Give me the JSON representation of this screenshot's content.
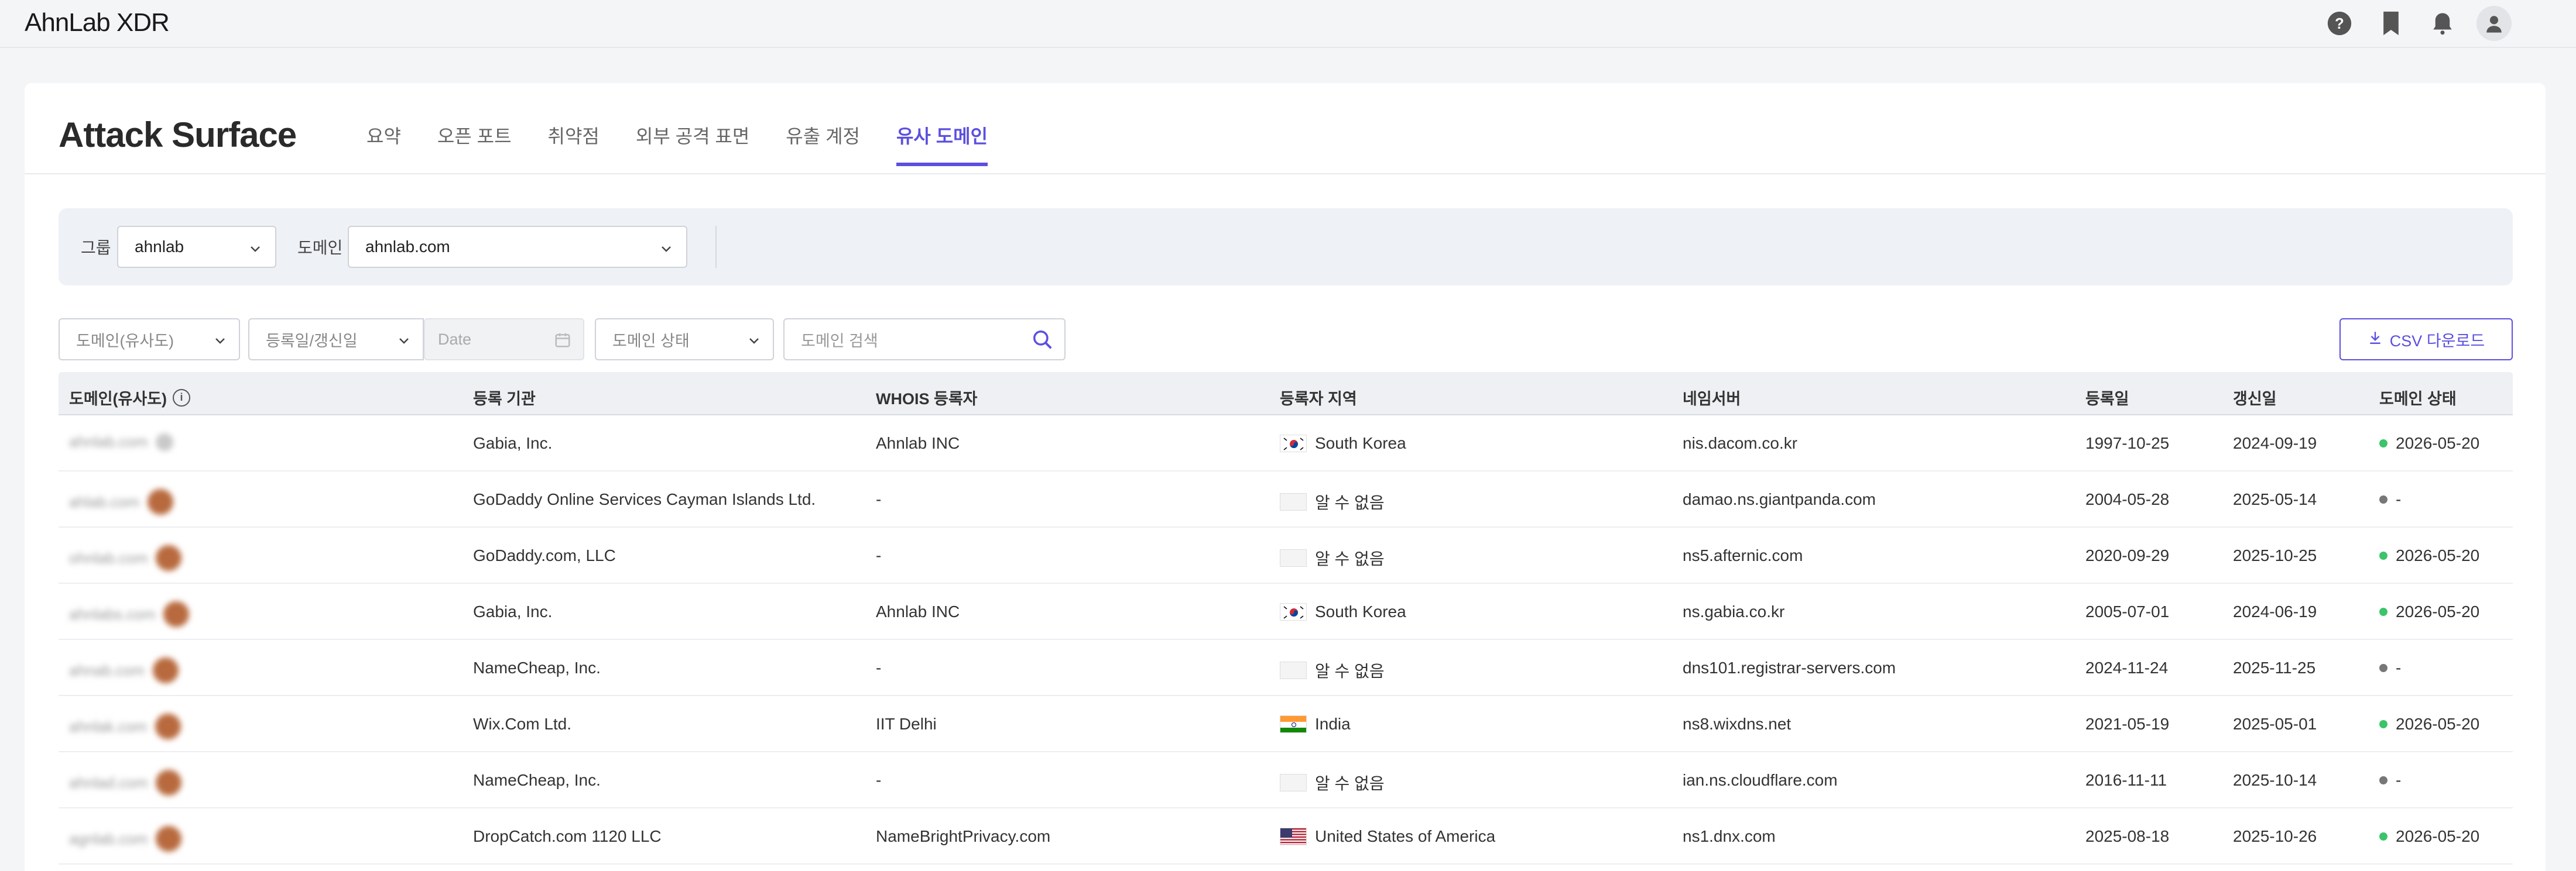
{
  "app": {
    "logo": "AhnLab XDR",
    "top_icons": [
      "help-icon",
      "bookmark-icon",
      "bell-icon",
      "user-icon"
    ]
  },
  "page": {
    "title": "Attack Surface",
    "tabs": [
      {
        "label": "요약",
        "active": false
      },
      {
        "label": "오픈 포트",
        "active": false
      },
      {
        "label": "취약점",
        "active": false
      },
      {
        "label": "외부 공격 표면",
        "active": false
      },
      {
        "label": "유출 계정",
        "active": false
      },
      {
        "label": "유사 도메인",
        "active": true
      }
    ]
  },
  "filters": {
    "group_label": "그룹",
    "group_value": "ahnlab",
    "domain_label": "도메인",
    "domain_value": "ahnlab.com"
  },
  "toolbar": {
    "similar_domain_select": "도메인(유사도)",
    "date_type_select": "등록일/갱신일",
    "date_placeholder": "Date",
    "status_select": "도메인 상태",
    "search_placeholder": "도메인 검색",
    "csv_button": "CSV 다운로드"
  },
  "table": {
    "headers": {
      "domain": "도메인(유사도)",
      "registrar": "등록 기관",
      "whois": "WHOIS 등록자",
      "region": "등록자 지역",
      "nameserver": "네임서버",
      "registered": "등록일",
      "renewed": "갱신일",
      "status": "도메인 상태"
    },
    "rows": [
      {
        "domain": "ahnlab.com",
        "registrar": "Gabia, Inc.",
        "whois": "Ahnlab INC",
        "flag": "kr",
        "region": "South Korea",
        "nameserver": "nis.dacom.co.kr",
        "registered": "1997-10-25",
        "renewed": "2024-09-19",
        "status": "2026-05-20",
        "status_color": "#3cc46b"
      },
      {
        "domain": "ahlab.com",
        "registrar": "GoDaddy Online Services Cayman Islands Ltd.",
        "whois": "-",
        "flag": "none",
        "region": "알 수 없음",
        "nameserver": "damao.ns.giantpanda.com",
        "registered": "2004-05-28",
        "renewed": "2025-05-14",
        "status": "-",
        "status_color": "#777777"
      },
      {
        "domain": "ohnlab.com",
        "registrar": "GoDaddy.com, LLC",
        "whois": "-",
        "flag": "none",
        "region": "알 수 없음",
        "nameserver": "ns5.afternic.com",
        "registered": "2020-09-29",
        "renewed": "2025-10-25",
        "status": "2026-05-20",
        "status_color": "#3cc46b"
      },
      {
        "domain": "ahnlabs.com",
        "registrar": "Gabia, Inc.",
        "whois": "Ahnlab INC",
        "flag": "kr",
        "region": "South Korea",
        "nameserver": "ns.gabia.co.kr",
        "registered": "2005-07-01",
        "renewed": "2024-06-19",
        "status": "2026-05-20",
        "status_color": "#3cc46b"
      },
      {
        "domain": "ahnab.com",
        "registrar": "NameCheap, Inc.",
        "whois": "-",
        "flag": "none",
        "region": "알 수 없음",
        "nameserver": "dns101.registrar-servers.com",
        "registered": "2024-11-24",
        "renewed": "2025-11-25",
        "status": "-",
        "status_color": "#777777"
      },
      {
        "domain": "ahnlak.com",
        "registrar": "Wix.Com Ltd.",
        "whois": "IIT Delhi",
        "flag": "in",
        "region": "India",
        "nameserver": "ns8.wixdns.net",
        "registered": "2021-05-19",
        "renewed": "2025-05-01",
        "status": "2026-05-20",
        "status_color": "#3cc46b"
      },
      {
        "domain": "ahnlad.com",
        "registrar": "NameCheap, Inc.",
        "whois": "-",
        "flag": "none",
        "region": "알 수 없음",
        "nameserver": "ian.ns.cloudflare.com",
        "registered": "2016-11-11",
        "renewed": "2025-10-14",
        "status": "-",
        "status_color": "#777777"
      },
      {
        "domain": "agnlab.com",
        "registrar": "DropCatch.com 1120 LLC",
        "whois": "NameBrightPrivacy.com",
        "flag": "us",
        "region": "United States of America",
        "nameserver": "ns1.dnx.com",
        "registered": "2025-08-18",
        "renewed": "2025-10-26",
        "status": "2026-05-20",
        "status_color": "#3cc46b"
      }
    ]
  },
  "colors": {
    "accent": "#5b4fe0",
    "status_active": "#3cc46b",
    "status_unknown": "#777777"
  }
}
